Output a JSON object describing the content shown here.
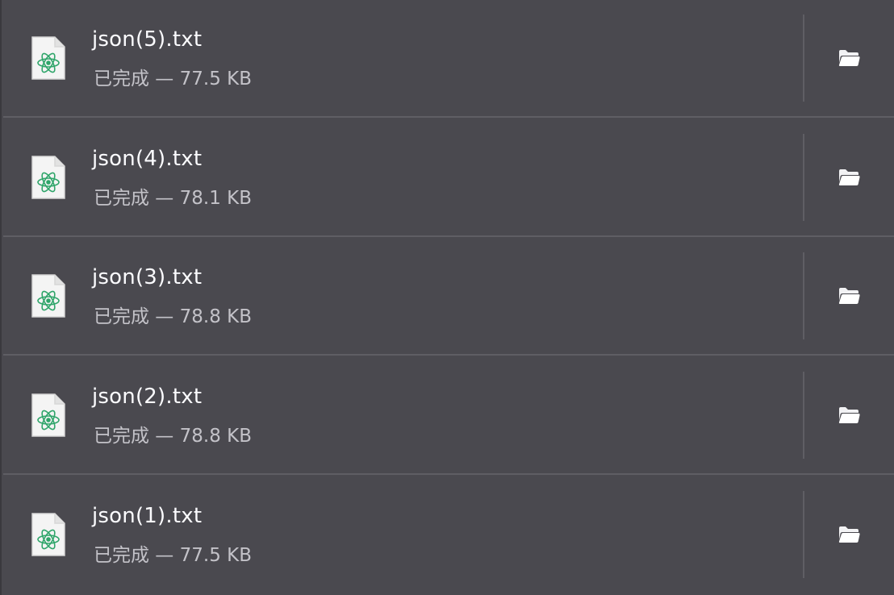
{
  "downloads": [
    {
      "filename": "json(5).txt",
      "status": "已完成 — 77.5 KB",
      "icon": "atom-file-icon",
      "action_icon": "folder-open-icon"
    },
    {
      "filename": "json(4).txt",
      "status": "已完成 — 78.1 KB",
      "icon": "atom-file-icon",
      "action_icon": "folder-open-icon"
    },
    {
      "filename": "json(3).txt",
      "status": "已完成 — 78.8 KB",
      "icon": "atom-file-icon",
      "action_icon": "folder-open-icon"
    },
    {
      "filename": "json(2).txt",
      "status": "已完成 — 78.8 KB",
      "icon": "atom-file-icon",
      "action_icon": "folder-open-icon"
    },
    {
      "filename": "json(1).txt",
      "status": "已完成 — 77.5 KB",
      "icon": "atom-file-icon",
      "action_icon": "folder-open-icon"
    }
  ],
  "colors": {
    "background": "#4a494f",
    "filename_text": "#fbfbfe",
    "status_text": "#c3c2c8",
    "icon_accent": "#2fa56a"
  }
}
